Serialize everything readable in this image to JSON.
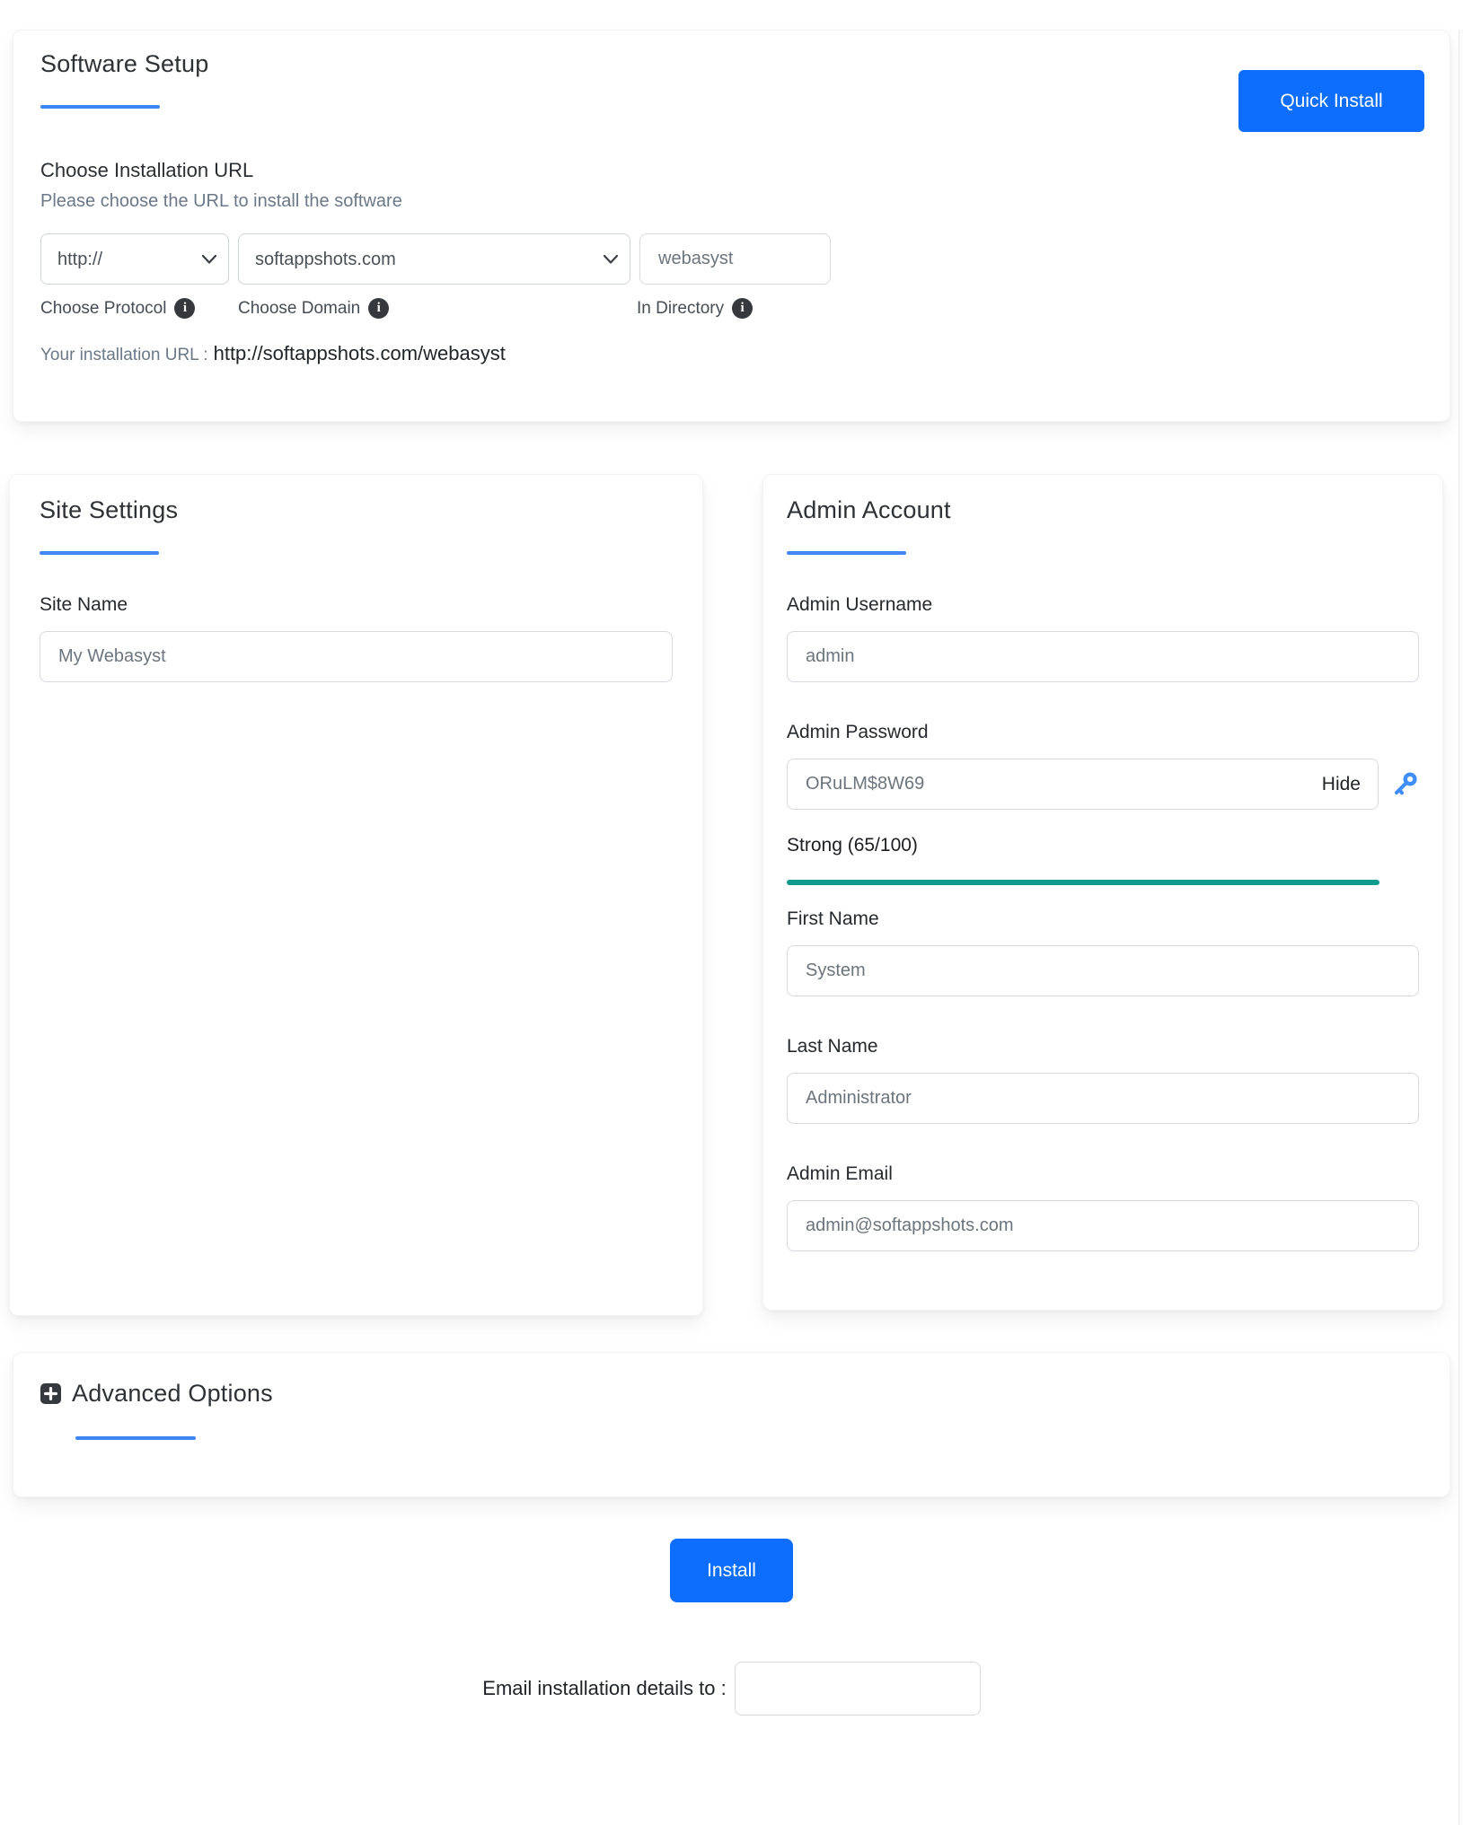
{
  "colors": {
    "primary_button": "#0d6efd",
    "heading_underline": "#3f86f5",
    "strength_bar": "#0f9b8d",
    "key_icon": "#3f8efc",
    "dark_icon": "#35393e"
  },
  "software_setup": {
    "title": "Software Setup",
    "quick_install_label": "Quick Install",
    "section_title": "Choose Installation URL",
    "section_subtitle": "Please choose the URL to install the software",
    "protocol": {
      "selected": "http://",
      "hint": "Choose Protocol"
    },
    "domain": {
      "selected": "softappshots.com",
      "hint": "Choose Domain"
    },
    "directory": {
      "value": "webasyst",
      "hint": "In Directory"
    },
    "installation_url_label": "Your installation URL :",
    "installation_url_value": "http://softappshots.com/webasyst"
  },
  "site_settings": {
    "title": "Site Settings",
    "site_name_label": "Site Name",
    "site_name_value": "My Webasyst"
  },
  "admin_account": {
    "title": "Admin Account",
    "username_label": "Admin Username",
    "username_value": "admin",
    "password_label": "Admin Password",
    "password_value": "ORuLM$8W69",
    "hide_label": "Hide",
    "strength_text": "Strong (65/100)",
    "strength_score": 65,
    "strength_max": 100,
    "first_name_label": "First Name",
    "first_name_value": "System",
    "last_name_label": "Last Name",
    "last_name_value": "Administrator",
    "email_label": "Admin Email",
    "email_value": "admin@softappshots.com"
  },
  "advanced_options": {
    "title": "Advanced Options",
    "expand_symbol": "+"
  },
  "footer": {
    "install_label": "Install",
    "email_details_label": "Email installation details to :",
    "email_details_value": ""
  }
}
